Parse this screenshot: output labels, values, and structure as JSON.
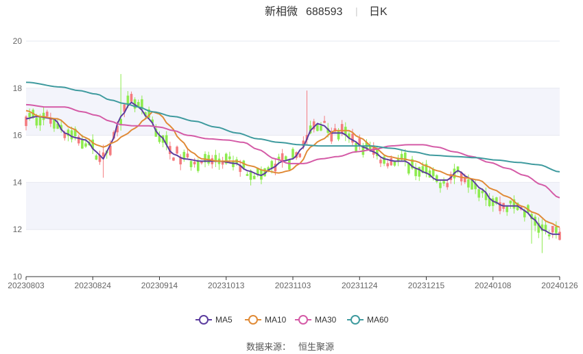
{
  "header": {
    "stock_name": "新相微",
    "stock_code": "688593",
    "period": "日K"
  },
  "footer": {
    "source_label": "数据来源：",
    "source_value": "恒生聚源"
  },
  "legend": [
    {
      "key": "ma5",
      "label": "MA5",
      "color": "#5b3c9e"
    },
    {
      "key": "ma10",
      "label": "MA10",
      "color": "#e08a36"
    },
    {
      "key": "ma30",
      "label": "MA30",
      "color": "#d45aa6"
    },
    {
      "key": "ma60",
      "label": "MA60",
      "color": "#3e9a9e"
    }
  ],
  "colors": {
    "up": "#f47b7f",
    "down": "#8deb4e",
    "band": "#f3f4fb",
    "grid": "#e6e8f0"
  },
  "chart_data": {
    "type": "candlestick",
    "ylim": [
      10,
      20
    ],
    "yticks": [
      10,
      12,
      14,
      16,
      18,
      20
    ],
    "xticks": [
      "20230803",
      "20230824",
      "20230914",
      "20231013",
      "20231103",
      "20231124",
      "20231215",
      "20240108",
      "20240126"
    ],
    "ma_anchors": {
      "ma5": [
        [
          0,
          16.7
        ],
        [
          3,
          16.8
        ],
        [
          8,
          16.7
        ],
        [
          11,
          16.1
        ],
        [
          14,
          15.9
        ],
        [
          17,
          15.8
        ],
        [
          20,
          15.3
        ],
        [
          22,
          15.0
        ],
        [
          24,
          15.6
        ],
        [
          27,
          16.8
        ],
        [
          30,
          17.4
        ],
        [
          32,
          17.2
        ],
        [
          35,
          16.7
        ],
        [
          38,
          16.0
        ],
        [
          42,
          15.2
        ],
        [
          45,
          15.0
        ],
        [
          50,
          14.9
        ],
        [
          55,
          14.9
        ],
        [
          60,
          14.8
        ],
        [
          63,
          14.5
        ],
        [
          67,
          14.3
        ],
        [
          70,
          14.6
        ],
        [
          73,
          14.9
        ],
        [
          76,
          15.0
        ],
        [
          79,
          15.5
        ],
        [
          81,
          16.2
        ],
        [
          83,
          16.5
        ],
        [
          85,
          16.4
        ],
        [
          87,
          16.1
        ],
        [
          90,
          16.1
        ],
        [
          93,
          15.8
        ],
        [
          96,
          15.5
        ],
        [
          99,
          15.3
        ],
        [
          102,
          15.0
        ],
        [
          105,
          14.9
        ],
        [
          108,
          14.9
        ],
        [
          111,
          14.6
        ],
        [
          114,
          14.4
        ],
        [
          117,
          14.1
        ],
        [
          120,
          14.1
        ],
        [
          123,
          14.5
        ],
        [
          126,
          14.2
        ],
        [
          130,
          13.7
        ],
        [
          133,
          13.2
        ],
        [
          136,
          13.0
        ],
        [
          140,
          13.0
        ],
        [
          142,
          12.8
        ],
        [
          145,
          12.4
        ],
        [
          147,
          12.0
        ],
        [
          150,
          11.8
        ],
        [
          152,
          11.8
        ]
      ],
      "ma10": [
        [
          0,
          17.05
        ],
        [
          4,
          16.8
        ],
        [
          9,
          16.7
        ],
        [
          13,
          16.3
        ],
        [
          17,
          15.9
        ],
        [
          20,
          15.6
        ],
        [
          22,
          15.5
        ],
        [
          25,
          15.7
        ],
        [
          28,
          16.0
        ],
        [
          31,
          16.3
        ],
        [
          34,
          16.7
        ],
        [
          36,
          17.0
        ],
        [
          38,
          16.9
        ],
        [
          41,
          16.4
        ],
        [
          44,
          15.8
        ],
        [
          47,
          15.3
        ],
        [
          50,
          15.0
        ],
        [
          55,
          14.9
        ],
        [
          60,
          14.9
        ],
        [
          64,
          14.7
        ],
        [
          68,
          14.5
        ],
        [
          72,
          14.4
        ],
        [
          75,
          14.5
        ],
        [
          78,
          14.8
        ],
        [
          81,
          15.5
        ],
        [
          84,
          15.8
        ],
        [
          88,
          16.2
        ],
        [
          92,
          16.2
        ],
        [
          95,
          15.9
        ],
        [
          99,
          15.5
        ],
        [
          103,
          15.1
        ],
        [
          107,
          15.0
        ],
        [
          111,
          14.9
        ],
        [
          114,
          14.7
        ],
        [
          117,
          14.5
        ],
        [
          121,
          14.3
        ],
        [
          125,
          14.2
        ],
        [
          129,
          14.1
        ],
        [
          133,
          13.7
        ],
        [
          137,
          13.4
        ],
        [
          141,
          13.0
        ],
        [
          145,
          12.7
        ],
        [
          149,
          12.3
        ],
        [
          152,
          12.1
        ]
      ],
      "ma30": [
        [
          0,
          17.3
        ],
        [
          6,
          17.2
        ],
        [
          11,
          17.2
        ],
        [
          16,
          17.0
        ],
        [
          20,
          16.85
        ],
        [
          24,
          16.6
        ],
        [
          27,
          16.45
        ],
        [
          31,
          16.4
        ],
        [
          35,
          16.4
        ],
        [
          38,
          16.35
        ],
        [
          42,
          16.2
        ],
        [
          46,
          16.0
        ],
        [
          52,
          15.85
        ],
        [
          57,
          15.8
        ],
        [
          62,
          15.7
        ],
        [
          66,
          15.4
        ],
        [
          71,
          15.0
        ],
        [
          75,
          14.8
        ],
        [
          79,
          14.8
        ],
        [
          84,
          15.0
        ],
        [
          89,
          15.1
        ],
        [
          94,
          15.3
        ],
        [
          99,
          15.4
        ],
        [
          104,
          15.55
        ],
        [
          109,
          15.6
        ],
        [
          113,
          15.6
        ],
        [
          117,
          15.5
        ],
        [
          122,
          15.3
        ],
        [
          127,
          15.1
        ],
        [
          132,
          14.85
        ],
        [
          137,
          14.6
        ],
        [
          142,
          14.3
        ],
        [
          147,
          13.9
        ],
        [
          152,
          13.35
        ]
      ],
      "ma60": [
        [
          0,
          18.25
        ],
        [
          10,
          18.05
        ],
        [
          15,
          17.9
        ],
        [
          20,
          17.75
        ],
        [
          24,
          17.5
        ],
        [
          28,
          17.35
        ],
        [
          32,
          17.2
        ],
        [
          36,
          17.0
        ],
        [
          42,
          16.8
        ],
        [
          48,
          16.6
        ],
        [
          54,
          16.35
        ],
        [
          60,
          16.1
        ],
        [
          66,
          15.85
        ],
        [
          72,
          15.7
        ],
        [
          78,
          15.6
        ],
        [
          84,
          15.55
        ],
        [
          90,
          15.55
        ],
        [
          98,
          15.55
        ],
        [
          104,
          15.45
        ],
        [
          110,
          15.3
        ],
        [
          116,
          15.15
        ],
        [
          122,
          15.1
        ],
        [
          128,
          15.05
        ],
        [
          134,
          14.95
        ],
        [
          140,
          14.85
        ],
        [
          146,
          14.75
        ],
        [
          152,
          14.45
        ]
      ]
    }
  }
}
